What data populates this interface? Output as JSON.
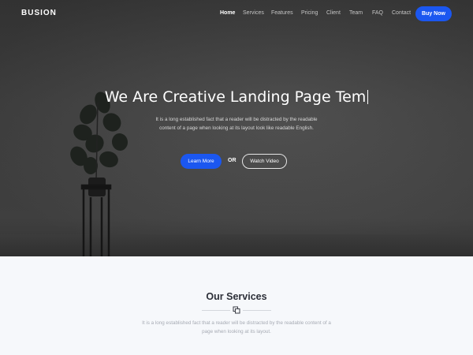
{
  "nav": {
    "brand": "BUSION",
    "items": [
      {
        "label": "Home",
        "active": true
      },
      {
        "label": "Services",
        "active": false
      },
      {
        "label": "Features",
        "active": false
      },
      {
        "label": "Pricing",
        "active": false
      },
      {
        "label": "Client",
        "active": false
      },
      {
        "label": "Team",
        "active": false
      },
      {
        "label": "FAQ",
        "active": false
      },
      {
        "label": "Contact",
        "active": false
      }
    ],
    "buy_label": "Buy Now"
  },
  "hero": {
    "headline": "We Are Creative Landing Page Tem",
    "subtext": "It is a long established fact that a reader will be distracted by the readable content of a page when looking at its layout look like readable English.",
    "learn_label": "Learn More",
    "or_label": "OR",
    "watch_label": "Watch Video"
  },
  "services": {
    "title": "Our Services",
    "text": "It is a long established fact that a reader will be distracted by the readable content of a page when looking at its layout."
  },
  "colors": {
    "accent": "#1b57f0",
    "hero_bg": "#444444",
    "section_bg": "#f6f8fb"
  },
  "icons": {
    "services_divider": "copy-icon"
  }
}
